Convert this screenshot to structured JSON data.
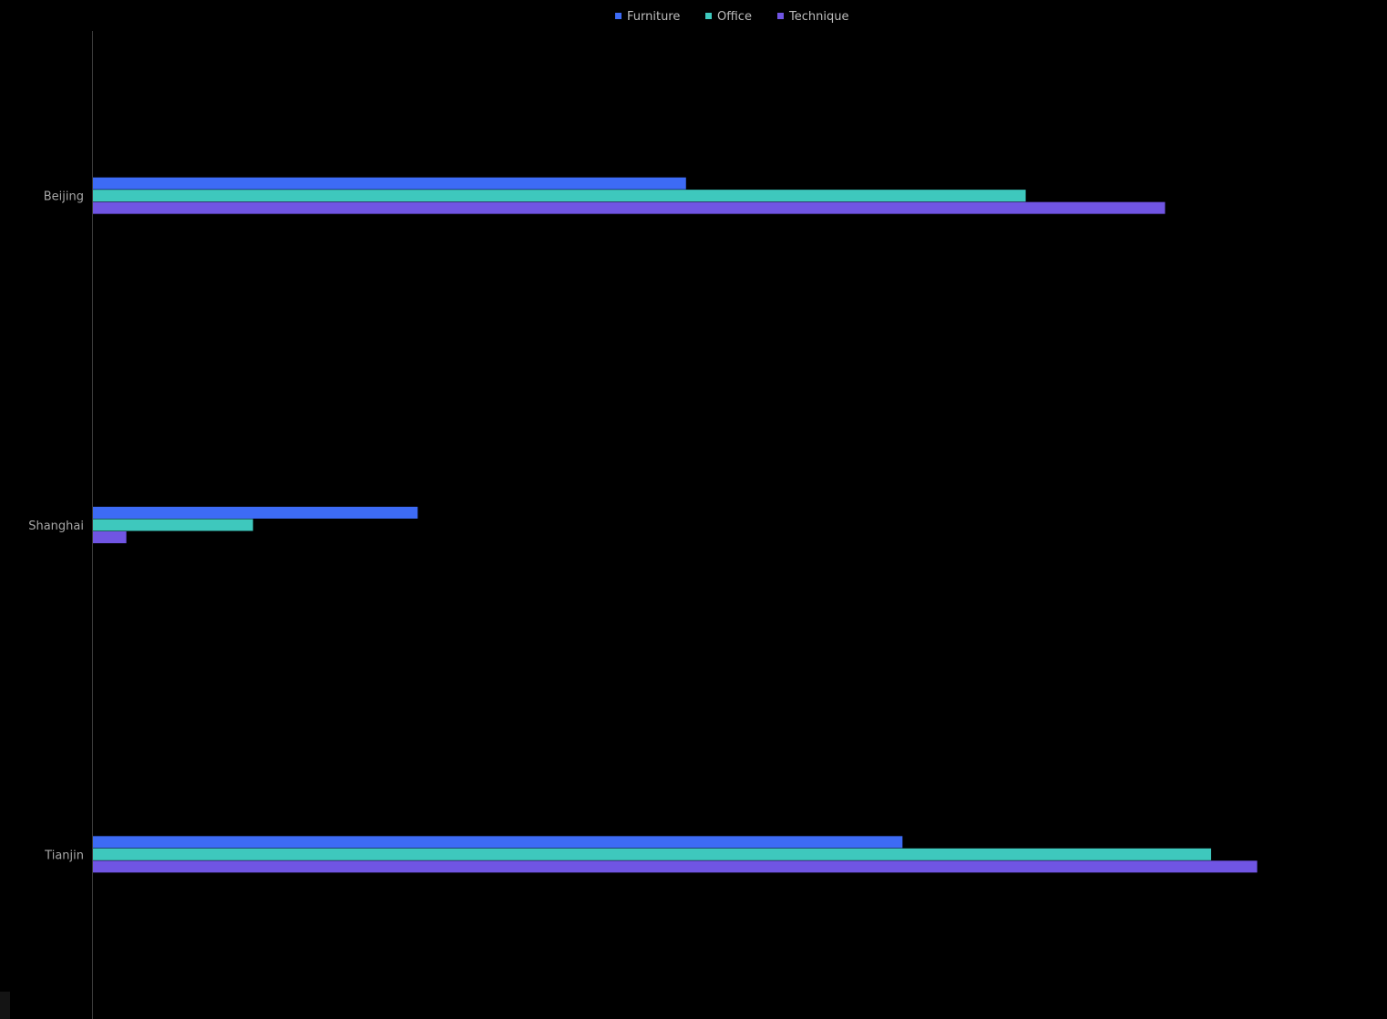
{
  "chart_data": {
    "type": "bar",
    "orientation": "horizontal",
    "categories": [
      "Beijing",
      "Shanghai",
      "Tianjin"
    ],
    "series": [
      {
        "name": "Furniture",
        "color": "#3d6bf5",
        "values": [
          51.5,
          28.2,
          70.3
        ]
      },
      {
        "name": "Office",
        "color": "#3ec8bd",
        "values": [
          81.0,
          13.9,
          97.1
        ]
      },
      {
        "name": "Technique",
        "color": "#7055e3",
        "values": [
          93.1,
          2.9,
          101.1
        ]
      }
    ],
    "xlim": [
      0,
      110
    ],
    "grid": false,
    "legend": "top-center",
    "title": "",
    "xlabel": "",
    "ylabel": ""
  }
}
